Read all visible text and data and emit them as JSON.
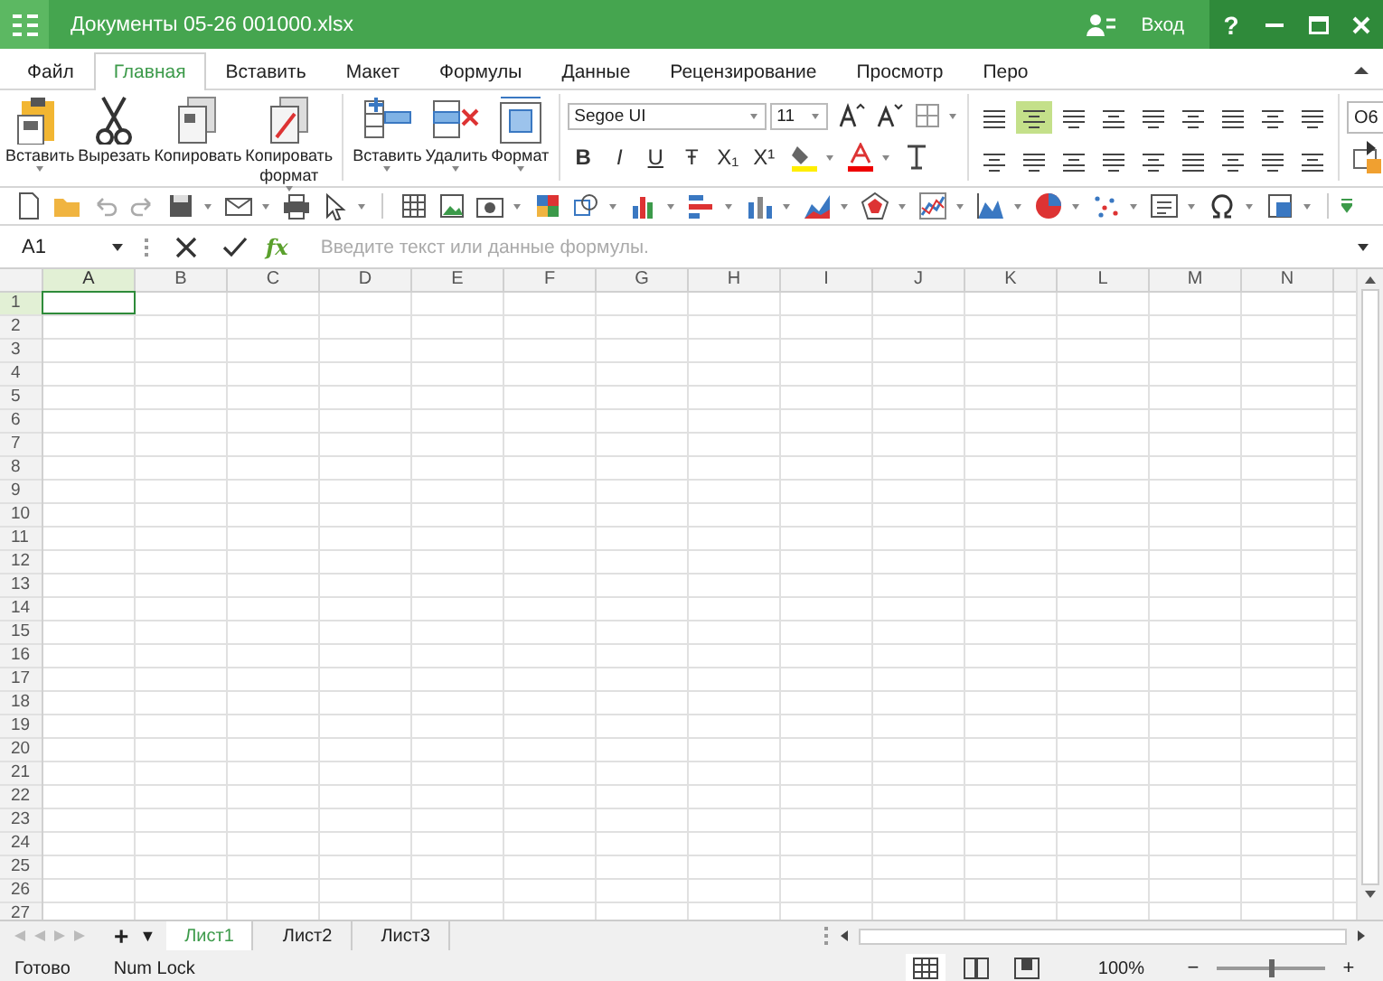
{
  "window": {
    "title": "Документы 05-26 001000.xlsx",
    "sign_in": "Вход",
    "help": "?"
  },
  "menu_tabs": [
    {
      "label": "Файл",
      "selected": false
    },
    {
      "label": "Главная",
      "selected": true
    },
    {
      "label": "Вставить",
      "selected": false
    },
    {
      "label": "Макет",
      "selected": false
    },
    {
      "label": "Формулы",
      "selected": false
    },
    {
      "label": "Данные",
      "selected": false
    },
    {
      "label": "Рецензирование",
      "selected": false
    },
    {
      "label": "Просмотр",
      "selected": false
    },
    {
      "label": "Перо",
      "selected": false
    }
  ],
  "ribbon": {
    "clipboard": [
      {
        "label": "Вставить",
        "dropdown": true
      },
      {
        "label": "Вырезать",
        "dropdown": false
      },
      {
        "label": "Копировать",
        "dropdown": false
      },
      {
        "label": "Копировать формат",
        "dropdown": true
      }
    ],
    "cells": [
      {
        "label": "Вставить",
        "dropdown": true
      },
      {
        "label": "Удалить",
        "dropdown": true
      },
      {
        "label": "Формат",
        "dropdown": true
      }
    ],
    "font_name": "Segoe UI",
    "font_size": "11",
    "format_buttons": [
      "B",
      "I",
      "U",
      "Ŧ",
      "X₁",
      "X¹"
    ],
    "align_top": [
      {
        "selected": false
      },
      {
        "selected": true
      },
      {
        "selected": false
      },
      {
        "selected": false
      },
      {
        "selected": false
      },
      {
        "selected": false
      },
      {
        "selected": false
      },
      {
        "selected": false
      },
      {
        "selected": false
      }
    ],
    "align_bottom": [
      {
        "selected": false
      },
      {
        "selected": false
      },
      {
        "selected": false
      },
      {
        "selected": false
      },
      {
        "selected": false
      },
      {
        "selected": false
      },
      {
        "selected": false
      },
      {
        "selected": false
      },
      {
        "selected": false
      }
    ],
    "number_format": "O6"
  },
  "formula_bar": {
    "name_box": "A1",
    "fx": "fx",
    "placeholder": "Введите текст или данные формулы."
  },
  "sheet": {
    "columns": [
      {
        "label": "A",
        "selected": true
      },
      {
        "label": "B",
        "selected": false
      },
      {
        "label": "C",
        "selected": false
      },
      {
        "label": "D",
        "selected": false
      },
      {
        "label": "E",
        "selected": false
      },
      {
        "label": "F",
        "selected": false
      },
      {
        "label": "G",
        "selected": false
      },
      {
        "label": "H",
        "selected": false
      },
      {
        "label": "I",
        "selected": false
      },
      {
        "label": "J",
        "selected": false
      },
      {
        "label": "K",
        "selected": false
      },
      {
        "label": "L",
        "selected": false
      },
      {
        "label": "M",
        "selected": false
      },
      {
        "label": "N",
        "selected": false
      }
    ],
    "rows": [
      {
        "label": "1",
        "selected": true
      },
      {
        "label": "2",
        "selected": false
      },
      {
        "label": "3",
        "selected": false
      },
      {
        "label": "4",
        "selected": false
      },
      {
        "label": "5",
        "selected": false
      },
      {
        "label": "6",
        "selected": false
      },
      {
        "label": "7",
        "selected": false
      },
      {
        "label": "8",
        "selected": false
      },
      {
        "label": "9",
        "selected": false
      },
      {
        "label": "10",
        "selected": false
      },
      {
        "label": "11",
        "selected": false
      },
      {
        "label": "12",
        "selected": false
      },
      {
        "label": "13",
        "selected": false
      },
      {
        "label": "14",
        "selected": false
      },
      {
        "label": "15",
        "selected": false
      },
      {
        "label": "16",
        "selected": false
      },
      {
        "label": "17",
        "selected": false
      },
      {
        "label": "18",
        "selected": false
      },
      {
        "label": "19",
        "selected": false
      },
      {
        "label": "20",
        "selected": false
      },
      {
        "label": "21",
        "selected": false
      },
      {
        "label": "22",
        "selected": false
      },
      {
        "label": "23",
        "selected": false
      },
      {
        "label": "24",
        "selected": false
      },
      {
        "label": "25",
        "selected": false
      },
      {
        "label": "26",
        "selected": false
      },
      {
        "label": "27",
        "selected": false
      }
    ]
  },
  "sheet_tabs": {
    "add": "+",
    "list": "▼",
    "tabs": [
      {
        "label": "Лист1",
        "selected": true
      },
      {
        "label": "Лист2",
        "selected": false
      },
      {
        "label": "Лист3",
        "selected": false
      }
    ]
  },
  "status_bar": {
    "ready": "Готово",
    "num_lock": "Num Lock",
    "zoom": "100%",
    "zoom_out": "−",
    "zoom_in": "+",
    "level": 0.5
  }
}
